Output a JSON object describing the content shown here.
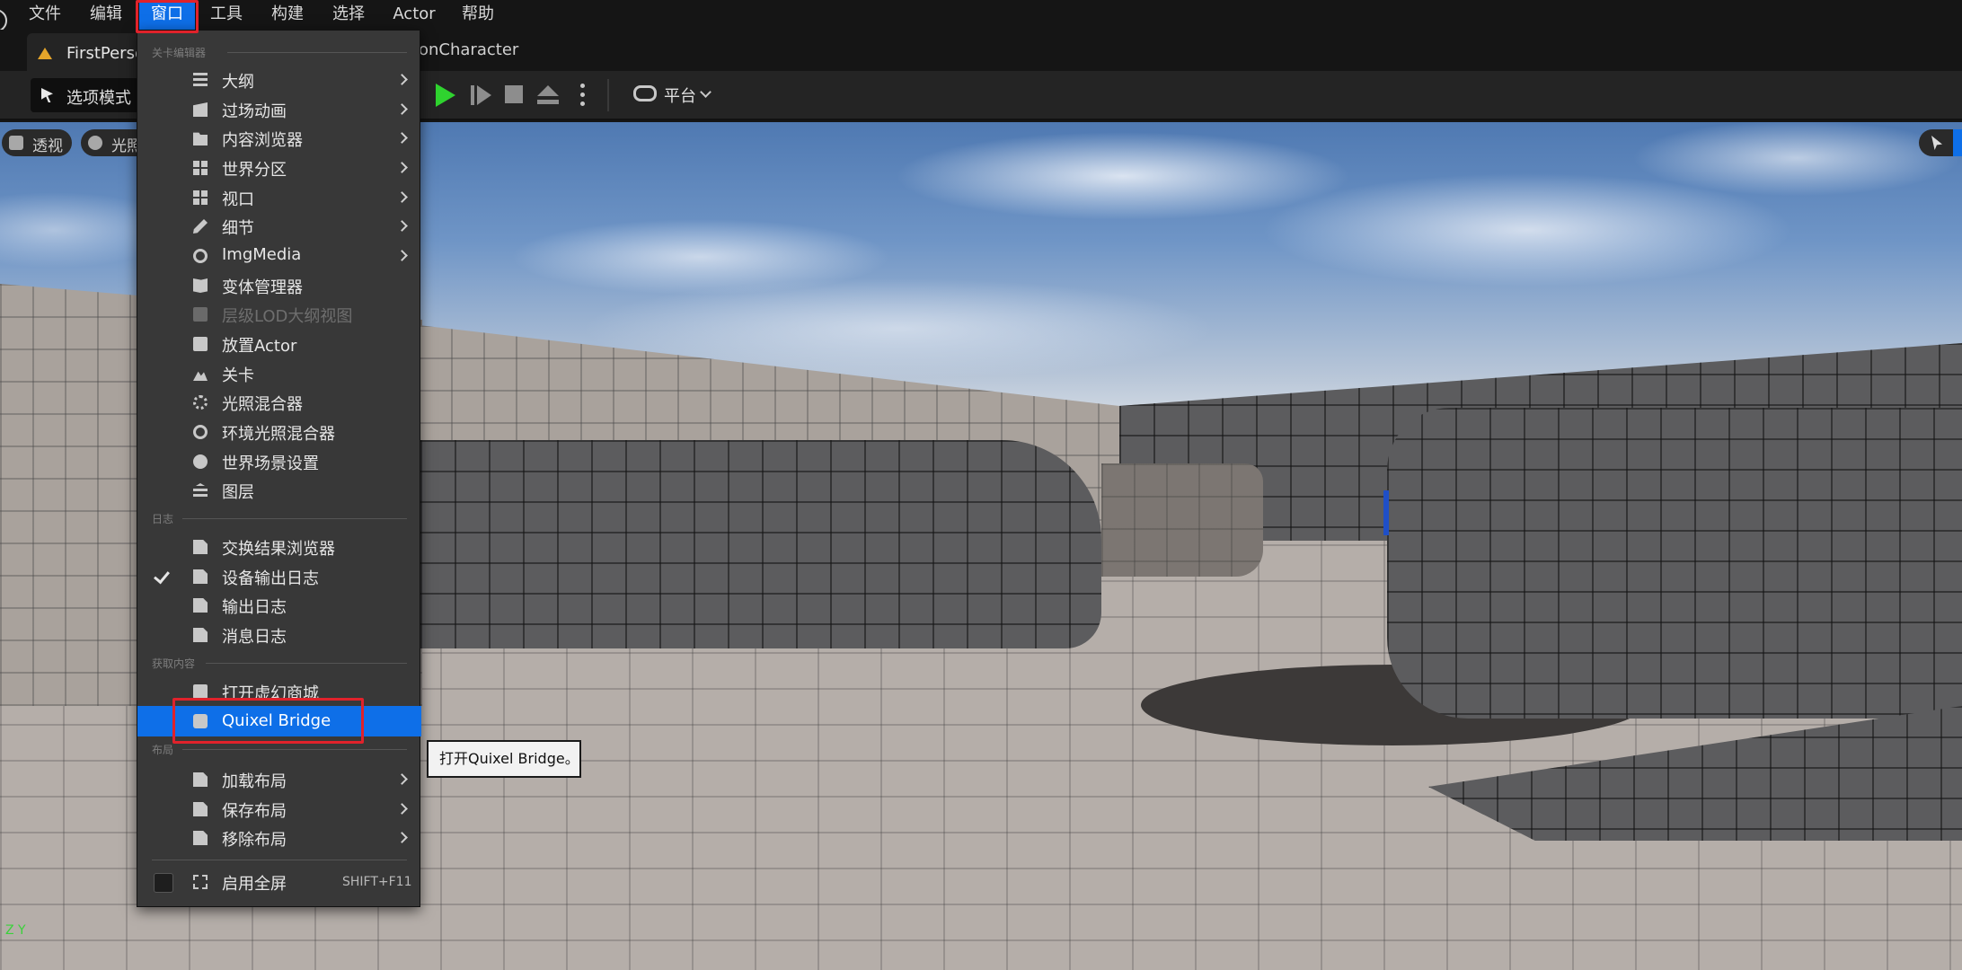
{
  "menubar": {
    "items": [
      "文件",
      "编辑",
      "窗口",
      "工具",
      "构建",
      "选择",
      "Actor",
      "帮助"
    ],
    "open_item": "窗口"
  },
  "tabs": {
    "active_tab": "FirstPerso",
    "second_tab_fragment": "onCharacter"
  },
  "toolbar": {
    "select_mode": "选项模式",
    "platform": "平台"
  },
  "viewport": {
    "perspective_label": "透视",
    "lighting_label": "光照",
    "axis_label": "Z Y"
  },
  "window_menu": {
    "sections": {
      "level_editor": "关卡编辑器",
      "log": "日志",
      "get_content": "获取内容",
      "layout": "布局"
    },
    "level_editor_items": [
      {
        "label": "大纲",
        "icon": "outliner-icon",
        "submenu": true
      },
      {
        "label": "过场动画",
        "icon": "cinematics-icon",
        "submenu": true
      },
      {
        "label": "内容浏览器",
        "icon": "content-browser-icon",
        "submenu": true
      },
      {
        "label": "世界分区",
        "icon": "world-partition-icon",
        "submenu": true
      },
      {
        "label": "视口",
        "icon": "viewport-icon",
        "submenu": true
      },
      {
        "label": "细节",
        "icon": "details-icon",
        "submenu": true
      },
      {
        "label": "ImgMedia",
        "icon": "imgmedia-icon",
        "submenu": true
      },
      {
        "label": "变体管理器",
        "icon": "variant-manager-icon",
        "submenu": false
      },
      {
        "label": "层级LOD大纲视图",
        "icon": "hlod-icon",
        "submenu": false,
        "disabled": true
      },
      {
        "label": "放置Actor",
        "icon": "place-actor-icon",
        "submenu": false
      },
      {
        "label": "关卡",
        "icon": "levels-icon",
        "submenu": false
      },
      {
        "label": "光照混合器",
        "icon": "light-mixer-icon",
        "submenu": false
      },
      {
        "label": "环境光照混合器",
        "icon": "env-light-mixer-icon",
        "submenu": false
      },
      {
        "label": "世界场景设置",
        "icon": "world-settings-icon",
        "submenu": false
      },
      {
        "label": "图层",
        "icon": "layers-icon",
        "submenu": false
      }
    ],
    "log_items": [
      {
        "label": "交换结果浏览器",
        "icon": "interchange-icon",
        "checked": false
      },
      {
        "label": "设备输出日志",
        "icon": "device-log-icon",
        "checked": true
      },
      {
        "label": "输出日志",
        "icon": "output-log-icon",
        "checked": false
      },
      {
        "label": "消息日志",
        "icon": "message-log-icon",
        "checked": false
      }
    ],
    "content_items": [
      {
        "label": "打开虚幻商城",
        "icon": "marketplace-icon"
      },
      {
        "label": "Quixel Bridge",
        "icon": "quixel-bridge-icon",
        "highlighted": true
      }
    ],
    "layout_items": [
      {
        "label": "加载布局",
        "icon": "load-layout-icon",
        "submenu": true
      },
      {
        "label": "保存布局",
        "icon": "save-layout-icon",
        "submenu": true
      },
      {
        "label": "移除布局",
        "icon": "remove-layout-icon",
        "submenu": true
      }
    ],
    "fullscreen": {
      "label": "启用全屏",
      "shortcut": "SHIFT+F11"
    }
  },
  "tooltip": {
    "text": "打开Quixel Bridge。"
  },
  "colors": {
    "accent": "#0e6fe8",
    "highlight_box": "#e0222b",
    "play": "#2fd32f"
  }
}
